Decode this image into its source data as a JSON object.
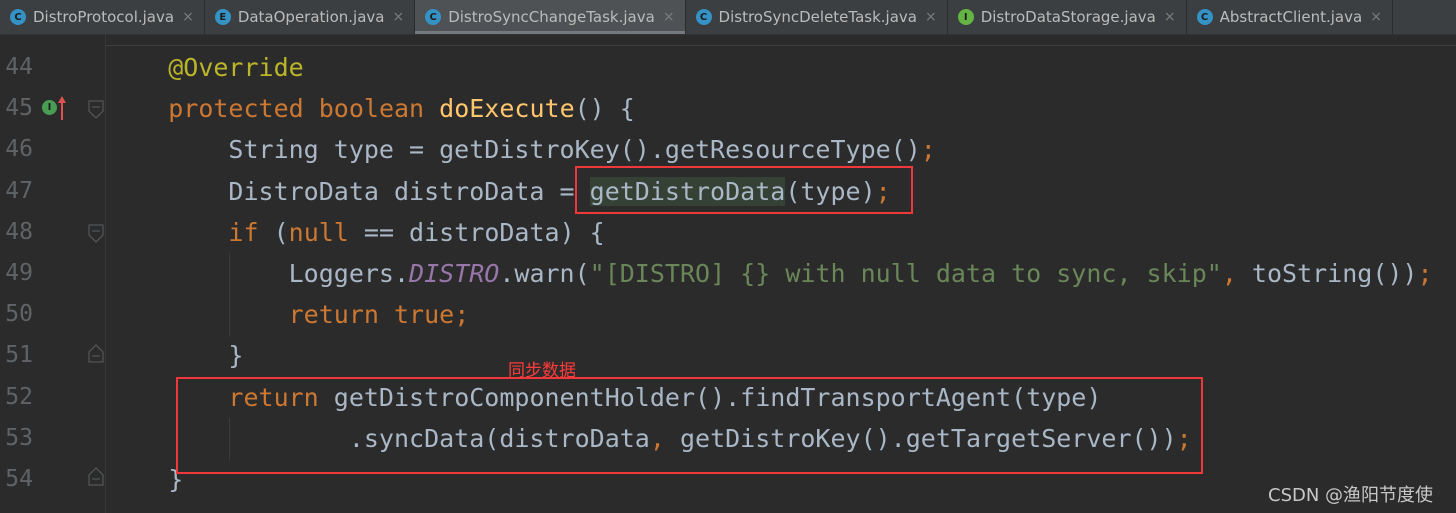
{
  "tabs": [
    {
      "label": "DistroProtocol.java",
      "icon": "class-icon",
      "icon_letter": "C",
      "icon_color": "#3592c4",
      "active": false
    },
    {
      "label": "DataOperation.java",
      "icon": "enum-icon",
      "icon_letter": "E",
      "icon_color": "#3592c4",
      "active": false
    },
    {
      "label": "DistroSyncChangeTask.java",
      "icon": "class-icon",
      "icon_letter": "C",
      "icon_color": "#3592c4",
      "active": true
    },
    {
      "label": "DistroSyncDeleteTask.java",
      "icon": "class-icon",
      "icon_letter": "C",
      "icon_color": "#3592c4",
      "active": false
    },
    {
      "label": "DistroDataStorage.java",
      "icon": "interface-icon",
      "icon_letter": "I",
      "icon_color": "#62b543",
      "active": false
    },
    {
      "label": "AbstractClient.java",
      "icon": "abstract-class-icon",
      "icon_letter": "C",
      "icon_color": "#3592c4",
      "active": false
    }
  ],
  "close_glyph": "×",
  "colors": {
    "keyword": "#cc7832",
    "annotation": "#bbb529",
    "method_declaration": "#ffc66d",
    "string": "#6a8759",
    "static_field": "#9876aa",
    "text": "#a9b7c6",
    "background": "#2b2b2b",
    "highlight_box": "#f0373a"
  },
  "lines": [
    {
      "num": "44",
      "tokens": [
        [
          "    ",
          ""
        ],
        [
          "@Override",
          "ann"
        ]
      ]
    },
    {
      "num": "45",
      "tokens": [
        [
          "    ",
          ""
        ],
        [
          "protected ",
          "kw"
        ],
        [
          "boolean ",
          "kw"
        ],
        [
          "doExecute",
          "mdecl"
        ],
        [
          "() {",
          ""
        ]
      ]
    },
    {
      "num": "46",
      "tokens": [
        [
          "        String type = getDistroKey().getResourceType()",
          ""
        ],
        [
          ";",
          "kw"
        ]
      ]
    },
    {
      "num": "47",
      "tokens": [
        [
          "        DistroData distroData = ",
          ""
        ],
        [
          "getDistroData",
          "hl"
        ],
        [
          "(type)",
          ""
        ],
        [
          ";",
          "kw"
        ]
      ]
    },
    {
      "num": "48",
      "tokens": [
        [
          "        ",
          ""
        ],
        [
          "if ",
          "kw"
        ],
        [
          "(",
          ""
        ],
        [
          "null ",
          "kw"
        ],
        [
          "== distroData) {",
          ""
        ]
      ]
    },
    {
      "num": "49",
      "tokens": [
        [
          "            Loggers.",
          ""
        ],
        [
          "DISTRO",
          "fld"
        ],
        [
          ".warn(",
          ""
        ],
        [
          "\"[DISTRO] {} with null data to sync, skip\"",
          "str"
        ],
        [
          ", ",
          "kw"
        ],
        [
          "toString())",
          ""
        ],
        [
          ";",
          "kw"
        ]
      ]
    },
    {
      "num": "50",
      "tokens": [
        [
          "            ",
          ""
        ],
        [
          "return true;",
          "kw"
        ]
      ]
    },
    {
      "num": "51",
      "tokens": [
        [
          "        }",
          ""
        ]
      ]
    },
    {
      "num": "52",
      "tokens": [
        [
          "        ",
          ""
        ],
        [
          "return ",
          "kw"
        ],
        [
          "getDistroComponentHolder().findTransportAgent(type)",
          ""
        ]
      ]
    },
    {
      "num": "53",
      "tokens": [
        [
          "                .syncData(distroData",
          ""
        ],
        [
          ", ",
          "kw"
        ],
        [
          "getDistroKey().getTargetServer())",
          ""
        ],
        [
          ";",
          "kw"
        ]
      ]
    },
    {
      "num": "54",
      "tokens": [
        [
          "    }",
          ""
        ]
      ]
    }
  ],
  "annotation_note": "同步数据",
  "watermark": "CSDN @渔阳节度使"
}
